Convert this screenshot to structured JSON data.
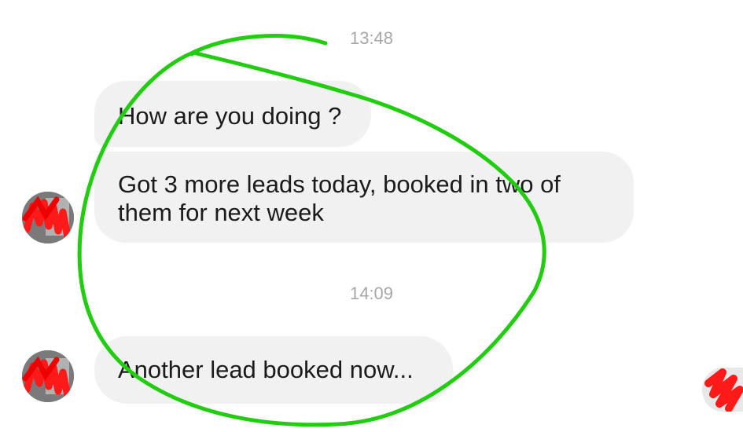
{
  "conversation": {
    "timestamps": [
      "13:48",
      "14:09"
    ],
    "messages": [
      {
        "text": "How are you doing ?"
      },
      {
        "text": "Got 3 more leads today, booked in two of them for next week"
      },
      {
        "text": "Another lead booked now..."
      }
    ]
  },
  "icons": {
    "avatar": "avatar-redacted-icon",
    "annotation": "green-circle-annotation"
  },
  "colors": {
    "bubble": "#f1f1f1",
    "timestamp": "#a7a7a7",
    "annotation": "#22cc11",
    "redaction": "#ff0000"
  }
}
